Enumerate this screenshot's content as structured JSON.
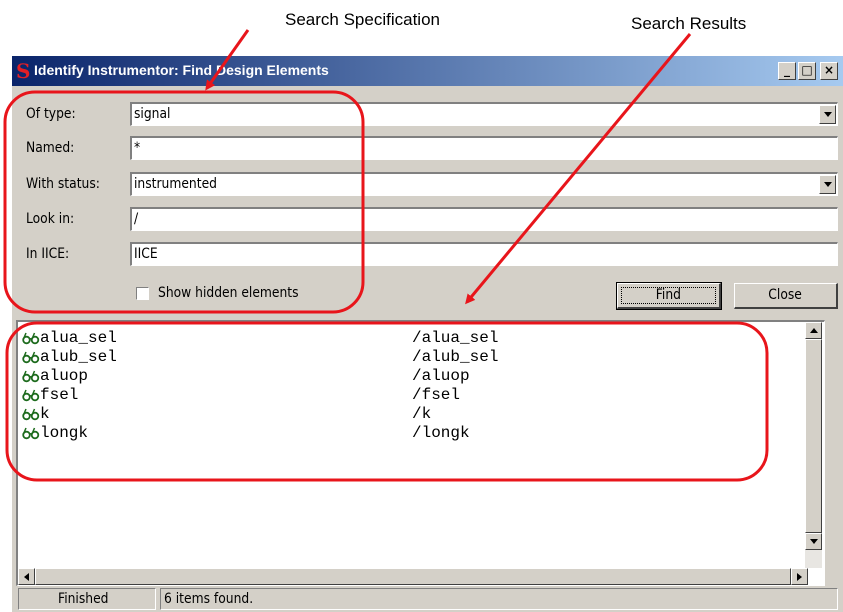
{
  "callouts": {
    "search_spec": "Search Specification",
    "search_results": "Search Results"
  },
  "window": {
    "title": "Identify Instrumentor: Find Design Elements",
    "minimize_glyph": "_",
    "maximize_glyph": "□",
    "close_glyph": "×"
  },
  "form": {
    "of_type_label": "Of type:",
    "of_type_value": "signal",
    "named_label": "Named:",
    "named_value": "*",
    "with_status_label": "With status:",
    "with_status_value": "instrumented",
    "look_in_label": "Look in:",
    "look_in_value": "/",
    "in_iice_label": "In IICE:",
    "in_iice_value": "IICE",
    "show_hidden_label": "Show hidden elements",
    "show_hidden_checked": false
  },
  "buttons": {
    "find": "Find",
    "close": "Close"
  },
  "results": [
    {
      "name": "alua_sel",
      "path": "/alua_sel"
    },
    {
      "name": "alub_sel",
      "path": "/alub_sel"
    },
    {
      "name": "aluop",
      "path": "/aluop"
    },
    {
      "name": "fsel",
      "path": "/fsel"
    },
    {
      "name": "k",
      "path": "/k"
    },
    {
      "name": "longk",
      "path": "/longk"
    }
  ],
  "result_icon": "glasses-icon",
  "status": {
    "state": "Finished",
    "message": "6 items found."
  },
  "colors": {
    "callout_red": "#e8151b",
    "icon_green": "#1d6b1d",
    "titlebar_start": "#0a246a",
    "titlebar_end": "#a6caf0"
  }
}
